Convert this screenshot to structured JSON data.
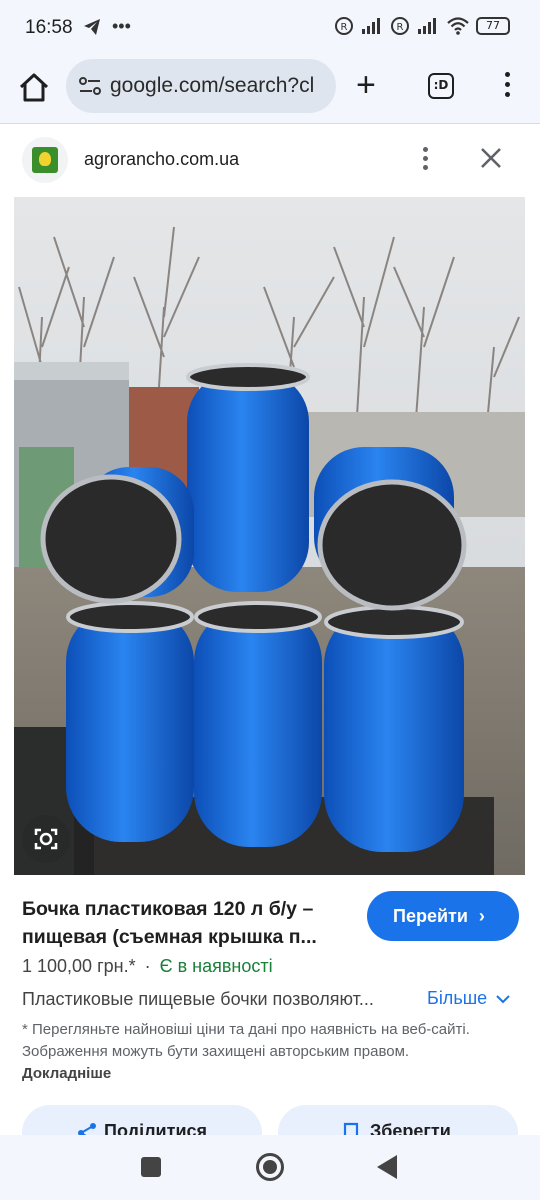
{
  "status": {
    "time": "16:58",
    "battery": "77"
  },
  "browser": {
    "url": "google.com/search?cl",
    "tab_count": ":D"
  },
  "panel": {
    "site": "agrorancho.com.ua",
    "title": "Бочка пластиковая 120 л б/у – пищевая (съемная крышка п...",
    "go_label": "Перейти",
    "price": "1 100,00 грн.*",
    "separator": "·",
    "availability": "Є в наявності",
    "description": "Пластиковые пищевые бочки позволяют...",
    "more_label": "Більше",
    "disclaimer": "* Перегляньте найновіші ціни та дані про наявність на веб-сайті. Зображення можуть бути захищені авторським правом.",
    "disclaimer_link": "Докладніше",
    "share_label": "Поділитися",
    "save_label": "Зберегти"
  },
  "colors": {
    "accent": "#1a73e8",
    "availability": "#188038",
    "barrel_blue": "#1e6fe0"
  },
  "icons": [
    "home-icon",
    "tune-icon",
    "plus-icon",
    "tabs-icon",
    "menu-icon",
    "more-vert-icon",
    "close-icon",
    "lens-icon",
    "share-icon",
    "bookmark-icon",
    "chevron-right-icon",
    "chevron-down-icon"
  ]
}
